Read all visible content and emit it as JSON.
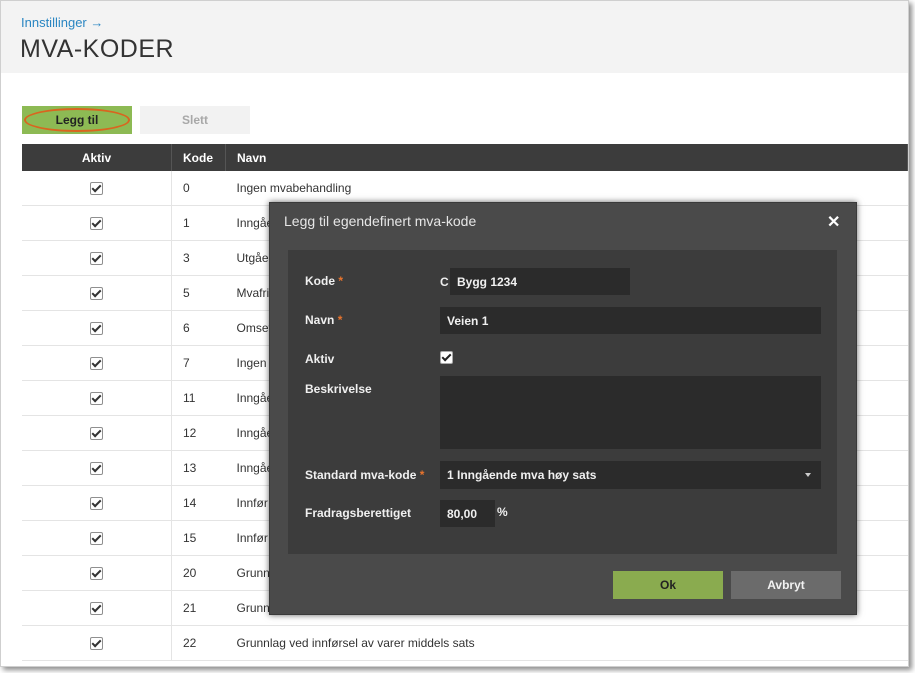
{
  "header": {
    "breadcrumb": "Innstillinger →",
    "title": "MVA-KODER"
  },
  "toolbar": {
    "add_label": "Legg til",
    "delete_label": "Slett"
  },
  "table": {
    "columns": [
      "Aktiv",
      "Kode",
      "Navn"
    ],
    "rows": [
      {
        "kode": "0",
        "navn": "Ingen mvabehandling"
      },
      {
        "kode": "1",
        "navn": "Inngåe"
      },
      {
        "kode": "3",
        "navn": "Utgåe"
      },
      {
        "kode": "5",
        "navn": "Mvafri"
      },
      {
        "kode": "6",
        "navn": "Omset"
      },
      {
        "kode": "7",
        "navn": "Ingen"
      },
      {
        "kode": "11",
        "navn": "Inngåe"
      },
      {
        "kode": "12",
        "navn": "Inngåe"
      },
      {
        "kode": "13",
        "navn": "Inngåe"
      },
      {
        "kode": "14",
        "navn": "Innfør"
      },
      {
        "kode": "15",
        "navn": "Innfør"
      },
      {
        "kode": "20",
        "navn": "Grunn"
      },
      {
        "kode": "21",
        "navn": "Grunn"
      },
      {
        "kode": "22",
        "navn": "Grunnlag ved innførsel av varer middels sats"
      }
    ]
  },
  "dialog": {
    "title": "Legg til egendefinert mva-kode",
    "close_symbol": "✕",
    "required_mark": "*",
    "fields": {
      "kode_label": "Kode",
      "kode_prefix": "C",
      "kode_value": "Bygg 1234",
      "navn_label": "Navn",
      "navn_value": "Veien 1",
      "aktiv_label": "Aktiv",
      "beskrivelse_label": "Beskrivelse",
      "beskrivelse_value": "",
      "standard_label": "Standard mva-kode",
      "standard_value": "1 Inngående mva høy sats",
      "fradrag_label": "Fradragsberettiget",
      "fradrag_value": "80,00",
      "fradrag_unit": "%"
    },
    "ok_label": "Ok",
    "cancel_label": "Avbryt"
  },
  "colors": {
    "accent_green": "#8dba54",
    "header_dark": "#3c3c3c",
    "link_blue": "#2a86c2",
    "highlight_orange": "#d9651f"
  }
}
